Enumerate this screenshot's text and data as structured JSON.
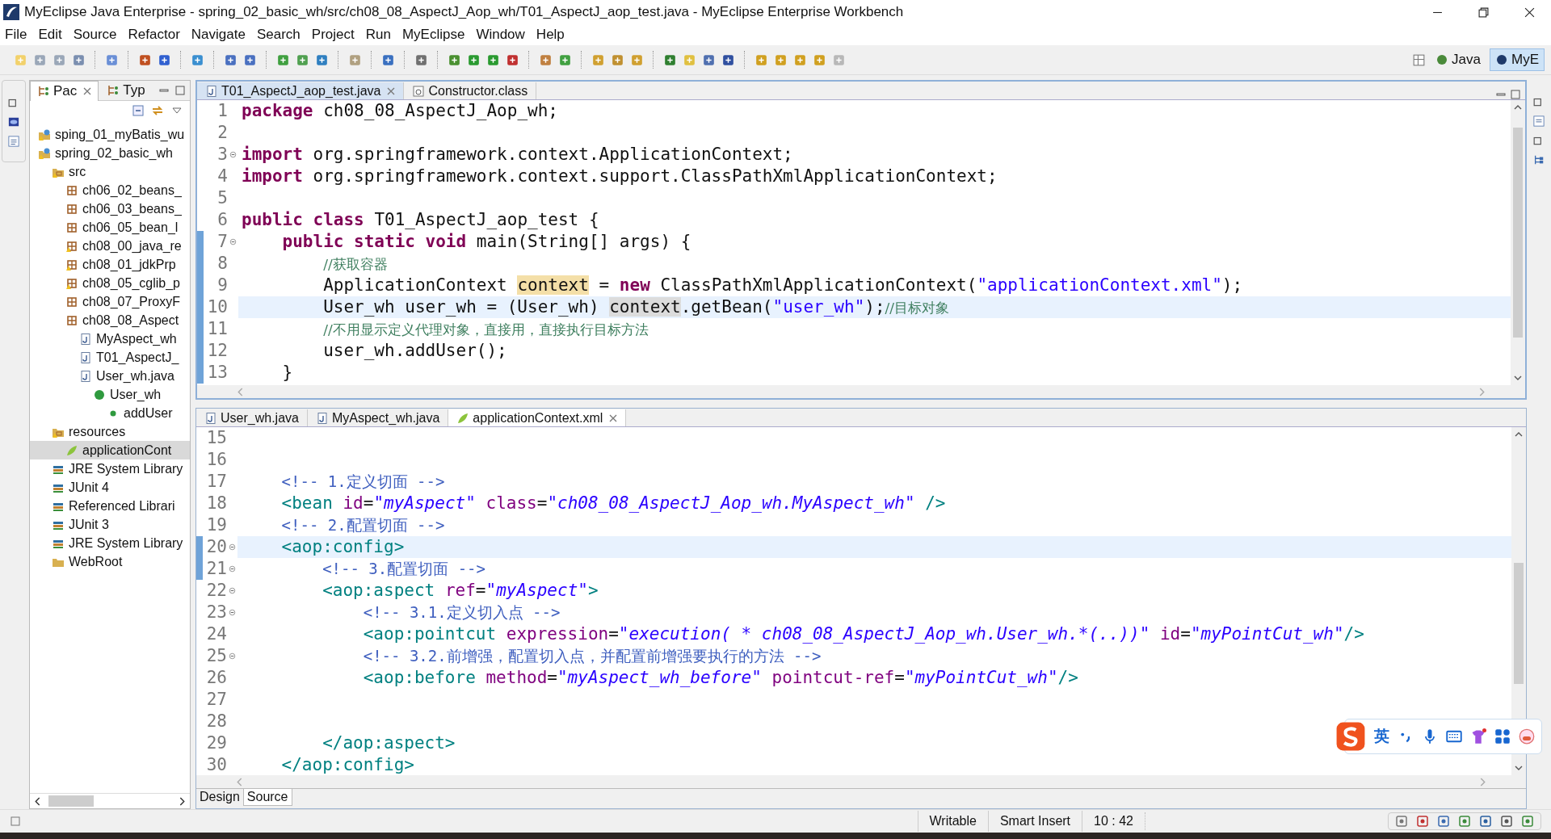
{
  "window": {
    "title": "MyEclipse Java Enterprise - spring_02_basic_wh/src/ch08_08_AspectJ_Aop_wh/T01_AspectJ_aop_test.java - MyEclipse Enterprise Workbench"
  },
  "menu": [
    "File",
    "Edit",
    "Source",
    "Refactor",
    "Navigate",
    "Search",
    "Project",
    "Run",
    "MyEclipse",
    "Window",
    "Help"
  ],
  "perspectives": [
    {
      "label": "Java",
      "selected": false
    },
    {
      "label": "MyE",
      "selected": true
    }
  ],
  "sidebar": {
    "tabs": [
      {
        "label": "Pac",
        "selected": true
      },
      {
        "label": "Typ",
        "selected": false
      }
    ],
    "tree": [
      {
        "label": "sping_01_myBatis_wu",
        "kind": "project",
        "selected": false
      },
      {
        "label": "spring_02_basic_wh",
        "kind": "project",
        "selected": false,
        "children": [
          {
            "label": "src",
            "kind": "source-folder",
            "selected": false,
            "children": [
              {
                "label": "ch06_02_beans_",
                "kind": "package",
                "selected": false
              },
              {
                "label": "ch06_03_beans_",
                "kind": "package",
                "selected": false
              },
              {
                "label": "ch06_05_bean_l",
                "kind": "package",
                "selected": false
              },
              {
                "label": "ch08_00_java_re",
                "kind": "package-warning",
                "selected": false
              },
              {
                "label": "ch08_01_jdkPrp",
                "kind": "package-warning",
                "selected": false
              },
              {
                "label": "ch08_05_cglib_p",
                "kind": "package-warning",
                "selected": false
              },
              {
                "label": "ch08_07_ProxyF",
                "kind": "package",
                "selected": false
              },
              {
                "label": "ch08_08_Aspect",
                "kind": "package",
                "selected": false,
                "children": [
                  {
                    "label": "MyAspect_wh",
                    "kind": "java-file",
                    "selected": false
                  },
                  {
                    "label": "T01_AspectJ_",
                    "kind": "java-file",
                    "selected": false
                  },
                  {
                    "label": "User_wh.java",
                    "kind": "java-file",
                    "selected": false,
                    "children": [
                      {
                        "label": "User_wh",
                        "kind": "class",
                        "selected": false,
                        "children": [
                          {
                            "label": "addUser",
                            "kind": "method",
                            "selected": false
                          }
                        ]
                      }
                    ]
                  }
                ]
              }
            ]
          },
          {
            "label": "resources",
            "kind": "source-folder",
            "selected": false,
            "children": [
              {
                "label": "applicationCont",
                "kind": "xml-file",
                "selected": true
              }
            ]
          },
          {
            "label": "JRE System Library",
            "kind": "library",
            "selected": false
          },
          {
            "label": "JUnit 4",
            "kind": "library",
            "selected": false
          },
          {
            "label": "Referenced Librari",
            "kind": "library",
            "selected": false
          },
          {
            "label": "JUnit 3",
            "kind": "library",
            "selected": false
          },
          {
            "label": "JRE System Library",
            "kind": "library",
            "selected": false
          },
          {
            "label": "WebRoot",
            "kind": "folder",
            "selected": false
          }
        ]
      }
    ]
  },
  "top_editor": {
    "tabs": [
      {
        "label": "T01_AspectJ_aop_test.java",
        "kind": "java",
        "selected": true
      },
      {
        "label": "Constructor.class",
        "kind": "class",
        "selected": false
      }
    ],
    "lines": [
      {
        "number": "1",
        "current": false,
        "fold": false,
        "marked": false,
        "tokens": [
          {
            "kind": "keyword",
            "text": "package"
          },
          {
            "kind": "plain",
            "text": " ch08_08_AspectJ_Aop_wh;"
          }
        ]
      },
      {
        "number": "2",
        "current": false,
        "fold": false,
        "marked": false
      },
      {
        "number": "3",
        "current": false,
        "fold": true,
        "marked": false,
        "tokens": [
          {
            "kind": "keyword",
            "text": "import"
          },
          {
            "kind": "plain",
            "text": " org.springframework.context.ApplicationContext;"
          }
        ]
      },
      {
        "number": "4",
        "current": false,
        "fold": false,
        "marked": false,
        "tokens": [
          {
            "kind": "keyword",
            "text": "import"
          },
          {
            "kind": "plain",
            "text": " org.springframework.context.support.ClassPathXmlApplicationContext;"
          }
        ]
      },
      {
        "number": "5",
        "current": false,
        "fold": false,
        "marked": false
      },
      {
        "number": "6",
        "current": false,
        "fold": false,
        "marked": false,
        "tokens": [
          {
            "kind": "keyword",
            "text": "public class"
          },
          {
            "kind": "plain",
            "text": " T01_AspectJ_aop_test {"
          }
        ]
      },
      {
        "number": "7",
        "current": false,
        "fold": true,
        "marked": true,
        "tokens": [
          {
            "kind": "keyword",
            "text": "    public static void"
          },
          {
            "kind": "plain",
            "text": " main(String[] args) {"
          }
        ]
      },
      {
        "number": "8",
        "current": false,
        "fold": false,
        "marked": true,
        "tokens": [
          {
            "kind": "comment",
            "text": "        //获取容器"
          }
        ]
      },
      {
        "number": "9",
        "current": false,
        "fold": false,
        "marked": true,
        "tokens": [
          {
            "kind": "plain",
            "text": "        ApplicationContext "
          },
          {
            "kind": "write-occurrence",
            "text": "context"
          },
          {
            "kind": "plain",
            "text": " = "
          },
          {
            "kind": "keyword",
            "text": "new"
          },
          {
            "kind": "plain",
            "text": " ClassPathXmlApplicationContext("
          },
          {
            "kind": "string",
            "text": "\"applicationContext.xml\""
          },
          {
            "kind": "plain",
            "text": ");"
          }
        ]
      },
      {
        "number": "10",
        "current": true,
        "fold": false,
        "marked": true,
        "tokens": [
          {
            "kind": "plain",
            "text": "        User_wh user_wh = (User_wh) "
          },
          {
            "kind": "read-occurrence",
            "text": "context"
          },
          {
            "kind": "plain",
            "text": ".getBean("
          },
          {
            "kind": "string",
            "text": "\"user_wh\""
          },
          {
            "kind": "plain",
            "text": ");"
          },
          {
            "kind": "comment",
            "text": "//目标对象"
          }
        ]
      },
      {
        "number": "11",
        "current": false,
        "fold": false,
        "marked": true,
        "tokens": [
          {
            "kind": "comment",
            "text": "        //不用显示定义代理对象，直接用，直接执行目标方法"
          }
        ]
      },
      {
        "number": "12",
        "current": false,
        "fold": false,
        "marked": true,
        "tokens": [
          {
            "kind": "plain",
            "text": "        user_wh.addUser();"
          }
        ]
      },
      {
        "number": "13",
        "current": false,
        "fold": false,
        "marked": true,
        "tokens": [
          {
            "kind": "plain",
            "text": "    }"
          }
        ]
      }
    ]
  },
  "bottom_editor": {
    "tabs": [
      {
        "label": "User_wh.java",
        "kind": "java",
        "selected": false
      },
      {
        "label": "MyAspect_wh.java",
        "kind": "java",
        "selected": false
      },
      {
        "label": "applicationContext.xml",
        "kind": "xml",
        "selected": true
      }
    ],
    "lines": [
      {
        "number": "15",
        "current": false,
        "fold": false,
        "marked": false
      },
      {
        "number": "16",
        "current": false,
        "fold": false,
        "marked": false
      },
      {
        "number": "17",
        "current": false,
        "fold": false,
        "marked": false,
        "tokens": [
          {
            "kind": "xml-comment",
            "text": "    <!-- 1.定义切面 -->"
          }
        ]
      },
      {
        "number": "18",
        "current": false,
        "fold": false,
        "marked": false,
        "tokens": [
          {
            "kind": "tag",
            "text": "    <bean"
          },
          {
            "kind": "attr",
            "text": " id"
          },
          {
            "kind": "plain",
            "text": "="
          },
          {
            "kind": "value",
            "text": "\"myAspect\""
          },
          {
            "kind": "attr",
            "text": " class"
          },
          {
            "kind": "plain",
            "text": "="
          },
          {
            "kind": "value",
            "text": "\"ch08_08_AspectJ_Aop_wh.MyAspect_wh\""
          },
          {
            "kind": "tag",
            "text": " />"
          }
        ]
      },
      {
        "number": "19",
        "current": false,
        "fold": false,
        "marked": false,
        "tokens": [
          {
            "kind": "xml-comment",
            "text": "    <!-- 2.配置切面 -->"
          }
        ]
      },
      {
        "number": "20",
        "current": true,
        "fold": true,
        "marked": true,
        "tokens": [
          {
            "kind": "tag",
            "text": "    <aop:config>"
          }
        ]
      },
      {
        "number": "21",
        "current": false,
        "fold": true,
        "marked": true,
        "tokens": [
          {
            "kind": "xml-comment",
            "text": "        <!-- 3.配置切面 -->"
          }
        ]
      },
      {
        "number": "22",
        "current": false,
        "fold": true,
        "marked": false,
        "tokens": [
          {
            "kind": "tag",
            "text": "        <aop:aspect"
          },
          {
            "kind": "attr",
            "text": " ref"
          },
          {
            "kind": "plain",
            "text": "="
          },
          {
            "kind": "value",
            "text": "\"myAspect\""
          },
          {
            "kind": "tag",
            "text": ">"
          }
        ]
      },
      {
        "number": "23",
        "current": false,
        "fold": true,
        "marked": false,
        "tokens": [
          {
            "kind": "xml-comment",
            "text": "            <!-- 3.1.定义切入点 -->"
          }
        ]
      },
      {
        "number": "24",
        "current": false,
        "fold": false,
        "marked": false,
        "tokens": [
          {
            "kind": "tag",
            "text": "            <aop:pointcut"
          },
          {
            "kind": "attr",
            "text": " expression"
          },
          {
            "kind": "plain",
            "text": "="
          },
          {
            "kind": "value",
            "text": "\"execution( * ch08_08_AspectJ_Aop_wh.User_wh.*(..))\""
          },
          {
            "kind": "attr",
            "text": " id"
          },
          {
            "kind": "plain",
            "text": "="
          },
          {
            "kind": "value",
            "text": "\"myPointCut_wh\""
          },
          {
            "kind": "tag",
            "text": "/>"
          }
        ]
      },
      {
        "number": "25",
        "current": false,
        "fold": true,
        "marked": false,
        "tokens": [
          {
            "kind": "xml-comment",
            "text": "            <!-- 3.2.前增强，配置切入点，并配置前增强要执行的方法 -->"
          }
        ]
      },
      {
        "number": "26",
        "current": false,
        "fold": false,
        "marked": false,
        "tokens": [
          {
            "kind": "tag",
            "text": "            <aop:before"
          },
          {
            "kind": "attr",
            "text": " method"
          },
          {
            "kind": "plain",
            "text": "="
          },
          {
            "kind": "value",
            "text": "\"myAspect_wh_before\""
          },
          {
            "kind": "attr",
            "text": " pointcut-ref"
          },
          {
            "kind": "plain",
            "text": "="
          },
          {
            "kind": "value",
            "text": "\"myPointCut_wh\""
          },
          {
            "kind": "tag",
            "text": "/>"
          }
        ]
      },
      {
        "number": "27",
        "current": false,
        "fold": false,
        "marked": false
      },
      {
        "number": "28",
        "current": false,
        "fold": false,
        "marked": false
      },
      {
        "number": "29",
        "current": false,
        "fold": false,
        "marked": false,
        "tokens": [
          {
            "kind": "tag",
            "text": "        </aop:aspect>"
          }
        ]
      },
      {
        "number": "30",
        "current": false,
        "fold": false,
        "marked": false,
        "tokens": [
          {
            "kind": "tag",
            "text": "    </aop:config>"
          }
        ]
      }
    ],
    "view_tabs": [
      {
        "label": "Design",
        "selected": false
      },
      {
        "label": "Source",
        "selected": true
      }
    ]
  },
  "ime_toolbar": {
    "mode": "英"
  },
  "status_bar": {
    "fields": [
      "Writable",
      "Smart Insert",
      "10 : 42"
    ]
  }
}
